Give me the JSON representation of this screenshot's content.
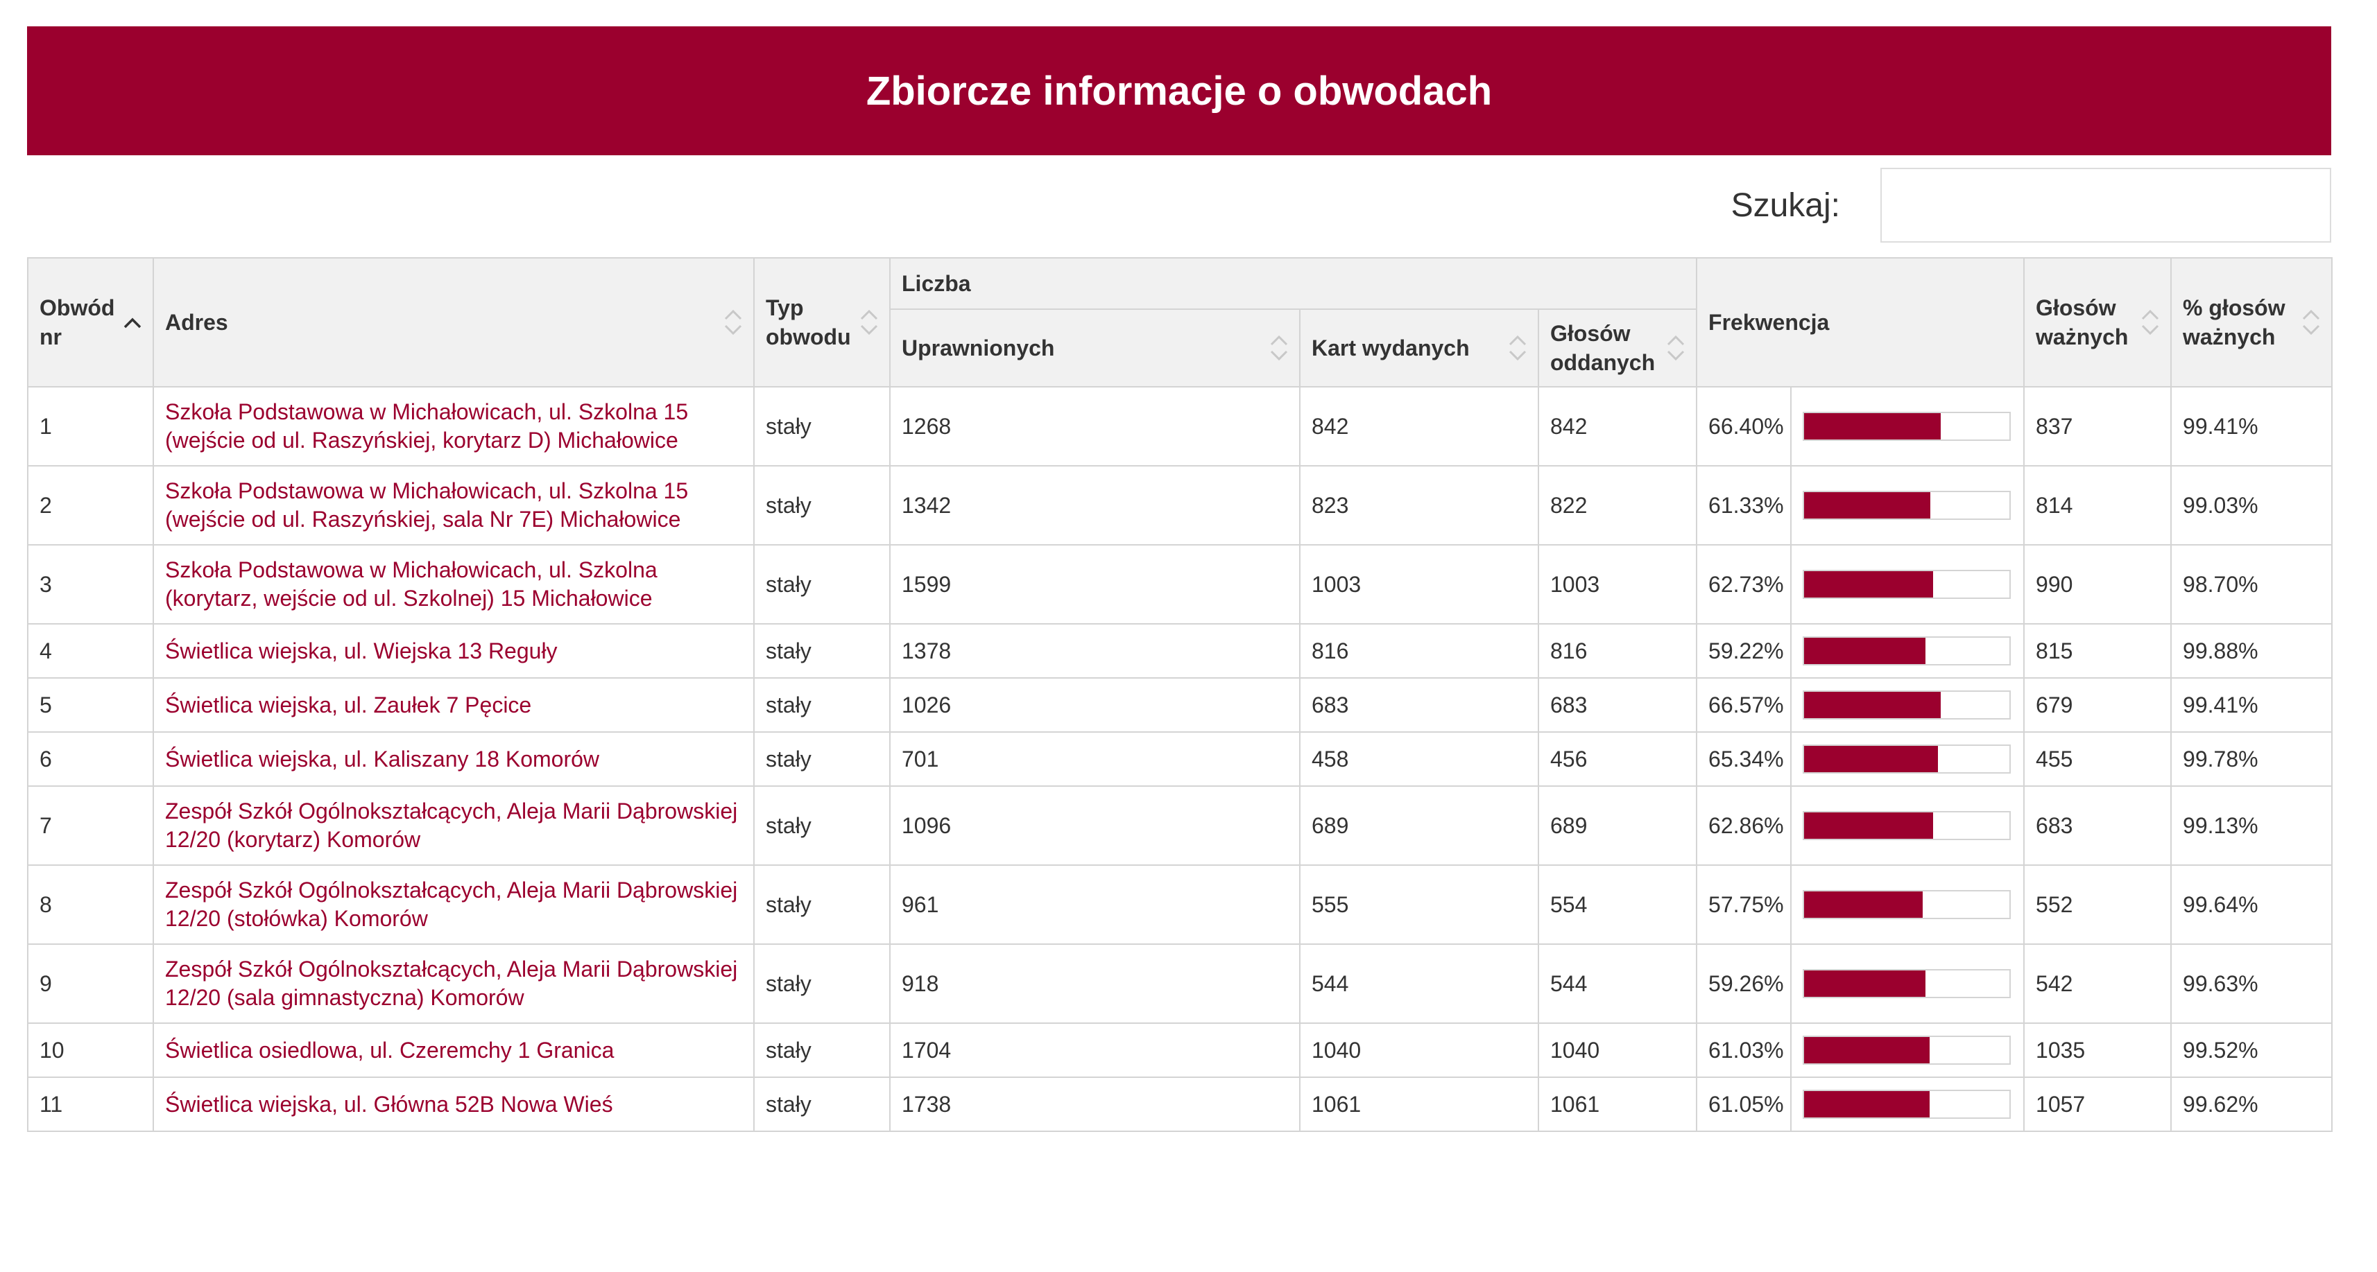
{
  "page": {
    "title": "Zbiorcze informacje o obwodach"
  },
  "search": {
    "label": "Szukaj:",
    "value": ""
  },
  "table": {
    "headers": {
      "obwod_nr": "Obwód nr",
      "adres": "Adres",
      "typ": "Typ obwodu",
      "liczba": "Liczba",
      "uprawnionych": "Uprawnionych",
      "kart": "Kart wydanych",
      "glosow_oddanych": "Głosów oddanych",
      "frekwencja": "Frekwencja",
      "glosow_waznych": "Głosów ważnych",
      "procent_waznych": "% głosów ważnych"
    },
    "accent_color": "#9b002e",
    "rows": [
      {
        "nr": "1",
        "adres": "Szkoła Podstawowa w Michałowicach, ul. Szkolna 15 (wejście od ul. Raszyńskiej, korytarz D) Michałowice",
        "typ": "stały",
        "uprawnionych": "1268",
        "kart": "842",
        "oddanych": "842",
        "frekwencja": "66.40%",
        "frekwencja_value": 66.4,
        "waznych": "837",
        "procent": "99.41%"
      },
      {
        "nr": "2",
        "adres": "Szkoła Podstawowa w Michałowicach, ul. Szkolna 15 (wejście od ul. Raszyńskiej, sala Nr 7E) Michałowice",
        "typ": "stały",
        "uprawnionych": "1342",
        "kart": "823",
        "oddanych": "822",
        "frekwencja": "61.33%",
        "frekwencja_value": 61.33,
        "waznych": "814",
        "procent": "99.03%"
      },
      {
        "nr": "3",
        "adres": "Szkoła Podstawowa w Michałowicach, ul. Szkolna (korytarz, wejście od ul. Szkolnej) 15 Michałowice",
        "typ": "stały",
        "uprawnionych": "1599",
        "kart": "1003",
        "oddanych": "1003",
        "frekwencja": "62.73%",
        "frekwencja_value": 62.73,
        "waznych": "990",
        "procent": "98.70%"
      },
      {
        "nr": "4",
        "adres": "Świetlica wiejska, ul. Wiejska 13 Reguły",
        "typ": "stały",
        "uprawnionych": "1378",
        "kart": "816",
        "oddanych": "816",
        "frekwencja": "59.22%",
        "frekwencja_value": 59.22,
        "waznych": "815",
        "procent": "99.88%"
      },
      {
        "nr": "5",
        "adres": "Świetlica wiejska, ul. Zaułek 7 Pęcice",
        "typ": "stały",
        "uprawnionych": "1026",
        "kart": "683",
        "oddanych": "683",
        "frekwencja": "66.57%",
        "frekwencja_value": 66.57,
        "waznych": "679",
        "procent": "99.41%"
      },
      {
        "nr": "6",
        "adres": "Świetlica wiejska, ul. Kaliszany 18 Komorów",
        "typ": "stały",
        "uprawnionych": "701",
        "kart": "458",
        "oddanych": "456",
        "frekwencja": "65.34%",
        "frekwencja_value": 65.34,
        "waznych": "455",
        "procent": "99.78%"
      },
      {
        "nr": "7",
        "adres": "Zespół Szkół Ogólnokształcących, Aleja Marii Dąbrowskiej 12/20 (korytarz) Komorów",
        "typ": "stały",
        "uprawnionych": "1096",
        "kart": "689",
        "oddanych": "689",
        "frekwencja": "62.86%",
        "frekwencja_value": 62.86,
        "waznych": "683",
        "procent": "99.13%"
      },
      {
        "nr": "8",
        "adres": "Zespół Szkół Ogólnokształcących, Aleja Marii Dąbrowskiej 12/20 (stołówka) Komorów",
        "typ": "stały",
        "uprawnionych": "961",
        "kart": "555",
        "oddanych": "554",
        "frekwencja": "57.75%",
        "frekwencja_value": 57.75,
        "waznych": "552",
        "procent": "99.64%"
      },
      {
        "nr": "9",
        "adres": "Zespół Szkół Ogólnokształcących, Aleja Marii Dąbrowskiej 12/20 (sala gimnastyczna) Komorów",
        "typ": "stały",
        "uprawnionych": "918",
        "kart": "544",
        "oddanych": "544",
        "frekwencja": "59.26%",
        "frekwencja_value": 59.26,
        "waznych": "542",
        "procent": "99.63%"
      },
      {
        "nr": "10",
        "adres": "Świetlica osiedlowa, ul. Czeremchy 1 Granica",
        "typ": "stały",
        "uprawnionych": "1704",
        "kart": "1040",
        "oddanych": "1040",
        "frekwencja": "61.03%",
        "frekwencja_value": 61.03,
        "waznych": "1035",
        "procent": "99.52%"
      },
      {
        "nr": "11",
        "adres": "Świetlica wiejska, ul. Główna 52B Nowa Wieś",
        "typ": "stały",
        "uprawnionych": "1738",
        "kart": "1061",
        "oddanych": "1061",
        "frekwencja": "61.05%",
        "frekwencja_value": 61.05,
        "waznych": "1057",
        "procent": "99.62%"
      }
    ]
  }
}
